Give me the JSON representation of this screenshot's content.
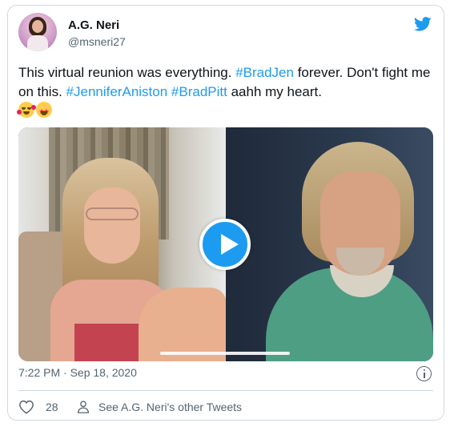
{
  "user": {
    "name": "A.G. Neri",
    "handle": "@msneri27"
  },
  "tweet": {
    "segments": [
      {
        "text": "This virtual reunion was everything. ",
        "type": "plain"
      },
      {
        "text": "#BradJen",
        "type": "hashtag"
      },
      {
        "text": " forever. Don't fight me on this. ",
        "type": "plain"
      },
      {
        "text": "#JenniferAniston",
        "type": "hashtag"
      },
      {
        "text": " ",
        "type": "plain"
      },
      {
        "text": "#BradPitt",
        "type": "hashtag"
      },
      {
        "text": " aahh my heart.",
        "type": "plain"
      }
    ],
    "emojis": [
      "smiling-face-with-hearts",
      "star-struck"
    ]
  },
  "media": {
    "type": "video",
    "play_icon": "play-icon"
  },
  "meta": {
    "timestamp": "7:22 PM · Sep 18, 2020"
  },
  "actions": {
    "like_count": "28",
    "other_tweets_label": "See A.G. Neri's other Tweets"
  },
  "icons": {
    "brand": "twitter-bird-icon",
    "info": "info-icon",
    "like": "heart-icon",
    "profile": "person-icon"
  },
  "colors": {
    "accent": "#1d9bf0",
    "text": "#0f1419",
    "secondary_text": "#536471",
    "border": "#cfd9de"
  }
}
